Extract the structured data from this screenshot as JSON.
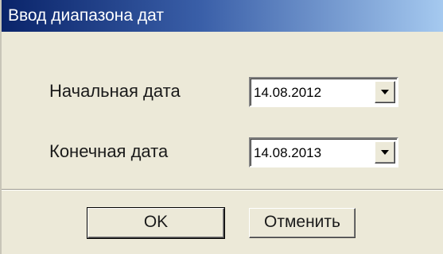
{
  "window": {
    "title": "Ввод диапазона дат"
  },
  "form": {
    "start_date_label": "Начальная дата",
    "start_date_value": "14.08.2012",
    "end_date_label": "Конечная дата",
    "end_date_value": "14.08.2013"
  },
  "buttons": {
    "ok_label": "OK",
    "cancel_label": "Отменить"
  },
  "colors": {
    "titlebar_start": "#0a246a",
    "titlebar_end": "#a6caf0",
    "dialog_background": "#ece9d8"
  },
  "icons": {
    "dropdown": "chevron-down-icon"
  }
}
